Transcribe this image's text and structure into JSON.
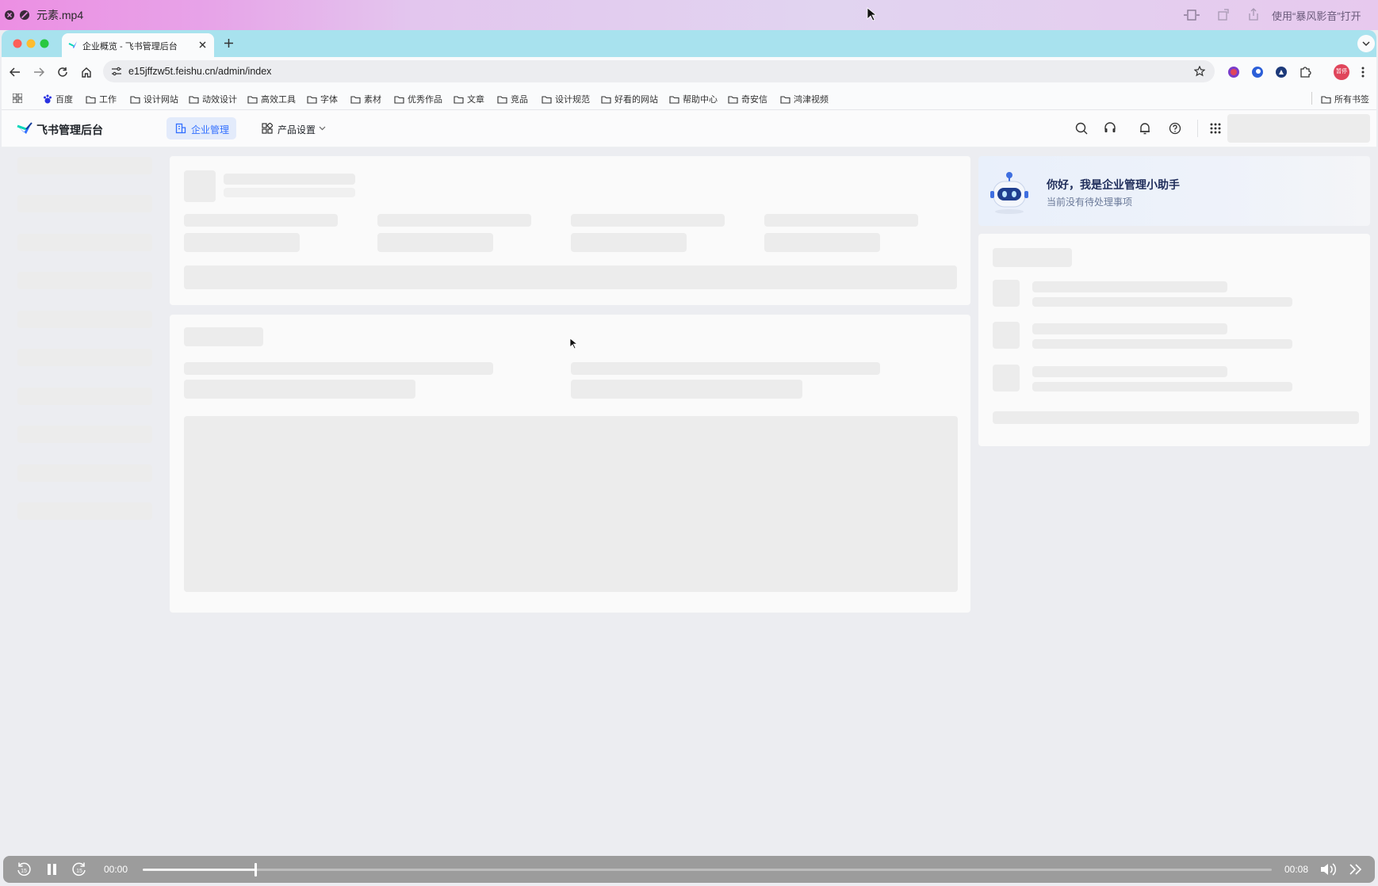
{
  "player": {
    "title": "元素.mp4",
    "open_with": "使用“暴风影音”打开",
    "time_current": "00:00",
    "time_total": "00:08",
    "progress": 0.1,
    "skip_seconds": "15"
  },
  "browser": {
    "tab_title": "企业概览 - 飞书管理后台",
    "url": "e15jffzw5t.feishu.cn/admin/index",
    "profile_label": "暂停",
    "bookmarks": [
      "百度",
      "工作",
      "设计网站",
      "动效设计",
      "高效工具",
      "字体",
      "素材",
      "优秀作品",
      "文章",
      "竞品",
      "设计规范",
      "好看的网站",
      "帮助中心",
      "奇安信",
      "鸿津视频"
    ],
    "all_bookmarks": "所有书签"
  },
  "app": {
    "title": "飞书管理后台",
    "nav": {
      "enterprise": "企业管理",
      "product": "产品设置"
    },
    "assistant": {
      "title": "你好，我是企业管理小助手",
      "subtitle": "当前没有待处理事项"
    }
  },
  "colors": {
    "accent": "#3370ff",
    "tabstrip": "#a8e2ee",
    "controls": "#9c9c9c"
  }
}
